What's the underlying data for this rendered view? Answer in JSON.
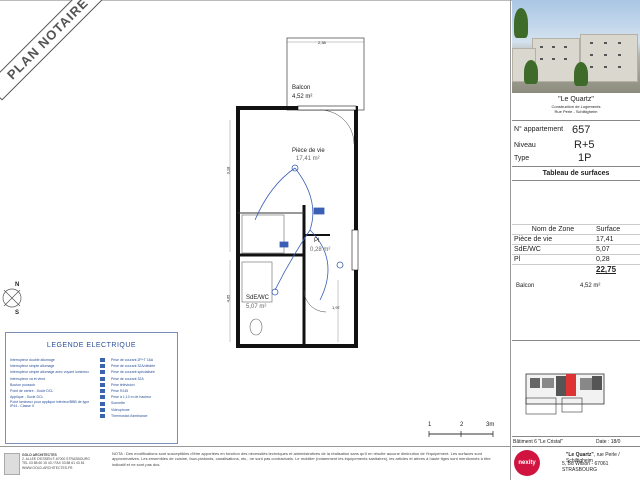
{
  "stamp": "PLAN NOTAIRE",
  "plan": {
    "balcon_label": "Balcon",
    "balcon_area": "4,52 m²",
    "balcon_width": "2,38",
    "piece_vie_label": "Pièce de vie",
    "piece_vie_area": "17,41 m²",
    "sde_label": "SdE/WC",
    "sde_area": "5,07 m²",
    "pl_label": "Pl",
    "pl_area": "0,28 m²",
    "dim_left": "3,18",
    "dim_left2": "4,05",
    "dim_mid": "1,97"
  },
  "compass": {
    "north": "N",
    "south": "S"
  },
  "legend": {
    "title": "LEGENDE ELECTRIQUE",
    "left_items": [
      "Interrupteur double allumage",
      "Interrupteur simple allumage",
      "Interrupteur simple allumage avec voyant lumineux",
      "Interrupteur va et vient",
      "Bouton poussoir",
      "Point de centre - Socle DCL",
      "Applique - Socle DCL",
      "Point lumineux pour applique intérieur/BBB de type IP44 - Classe II"
    ],
    "right_items": [
      "Prise de courant 2P+T 16A",
      "Prise de courant 32A/dédiée",
      "Prise de courant spécialisée",
      "Prise de courant 32A",
      "Prise télévision",
      "Prise RJ45",
      "Prise à 1,10 m de hauteur",
      "Sonnette",
      "Vidéophone",
      "Thermostat d'ambiance"
    ]
  },
  "scale": {
    "t0": "1",
    "t1": "2",
    "t2": "3m"
  },
  "footer": {
    "architect_lines": [
      "GOLD ARCHITECTES",
      "2, ALLEE D'ESSEN F-67000 STRASBOURG",
      "TEL 03 88 60 15 43 / FAX 03 88 61 43 81",
      "WWW.GOLD-ARCHITECTES.FR"
    ],
    "notice": "NOTA : Des modifications sont susceptibles d'être apportées en fonction des nécessités techniques et administratives de la réalisation sans qu'il en résulte aucune diminution de l'équipement. Les surfaces sont approximatives. Les ensembles de cuisine, faux-plafonds, canalisations, etc., ne sont pas contractuels. Le mobilier (notamment les équipements sanitaires), les articles et arbres à haute tiges sont mentionnés à titre indicatif et ne sont pas dus.",
    "promoter_name": "\"Le Quartz\"",
    "promoter_addr1": ", rue Perle / Schiltigheim",
    "promoter_addr2": "5, Bd Wilson - 67061 STRASBOURG"
  },
  "project": {
    "name": "\"Le Quartz\"",
    "sub1": "Construction de Logements",
    "sub2": "Rue Perle - Schiltigheim"
  },
  "info": {
    "appart_label": "N° appartement",
    "appart_value": "657",
    "niveau_label": "Niveau",
    "niveau_value": "R+5",
    "type_label": "Type",
    "type_value": "1P"
  },
  "surfaces": {
    "title": "Tableau de surfaces",
    "col1": "Nom de Zone",
    "col2": "Surface",
    "rows": [
      {
        "name": "Pièce de vie",
        "value": "17,41"
      },
      {
        "name": "SdE/WC",
        "value": "5,07"
      },
      {
        "name": "Pl",
        "value": "0,28"
      }
    ],
    "total": "22,75",
    "balcon_label": "Balcon",
    "balcon_value": "4,52 m²"
  },
  "bottom": {
    "batiment": "Bâtiment 6 \"Le Cristal\"",
    "date": "Date : 18/0"
  },
  "brand": "nexity"
}
